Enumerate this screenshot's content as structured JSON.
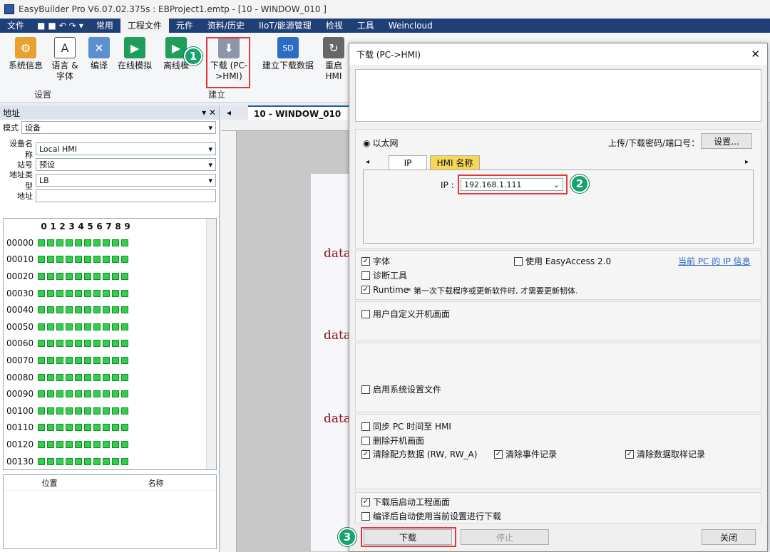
{
  "window": {
    "title": "EasyBuilder Pro V6.07.02.375s : EBProject1.emtp - [10 - WINDOW_010 ]"
  },
  "menu": {
    "items": [
      "文件",
      "常用",
      "工程文件",
      "元件",
      "资料/历史",
      "IIoT/能源管理",
      "检视",
      "工具",
      "Weincloud"
    ],
    "active": "工程文件"
  },
  "ribbon": {
    "buttons": [
      {
        "label": "系统信息"
      },
      {
        "label": "语言 & 字体"
      },
      {
        "label": "编译"
      },
      {
        "label": "在线模拟"
      },
      {
        "label": "离线模"
      },
      {
        "label": "下载 (PC->HMI)"
      },
      {
        "label": "建立下载数据"
      },
      {
        "label": "重启 HMI"
      }
    ],
    "group_settings": "设置",
    "group_build": "建立",
    "sd_text": "SD"
  },
  "badges": [
    "1",
    "2",
    "3"
  ],
  "left_panel": {
    "title": "地址",
    "mode_label": "模式",
    "mode_value": "设备",
    "device_label": "设备名称",
    "device_value": "Local HMI",
    "station_label": "站号",
    "station_value": "预设",
    "addrtype_label": "地址类型",
    "addrtype_value": "LB",
    "addr_label": "地址",
    "addr_value": "",
    "digits": [
      "0",
      "1",
      "2",
      "3",
      "4",
      "5",
      "6",
      "7",
      "8",
      "9"
    ],
    "rows": [
      "00000",
      "00010",
      "00020",
      "00030",
      "00040",
      "00050",
      "00060",
      "00070",
      "00080",
      "00090",
      "00100",
      "00110",
      "00120",
      "00130"
    ],
    "table_headers": [
      "位置",
      "名称"
    ]
  },
  "editor": {
    "tab": "10 - WINDOW_010",
    "labels": [
      "data",
      "data",
      "data"
    ]
  },
  "dialog": {
    "title": "下载 (PC->HMI)",
    "ethernet": "以太网",
    "password_label": "上传/下载密码/端口号：",
    "settings_btn": "设置...",
    "tab_ip": "IP",
    "tab_hmi": "HMI 名称",
    "ip_label": "IP :",
    "ip_value": "192.168.1.111",
    "fonts": "字体",
    "easyaccess": "使用 EasyAccess 2.0",
    "pc_ip_info": "当前 PC 的 IP 信息",
    "diag": "诊断工具",
    "runtime": "Runtime",
    "runtime_note": "* 第一次下载程序或更新软件时, 才需要更新韧体.",
    "custom_boot": "用户自定义开机画面",
    "sys_settings": "启用系统设置文件",
    "sync_time": "同步 PC 时间至 HMI",
    "delete_boot": "删除开机画面",
    "clear_recipe": "清除配方数据 (RW, RW_A)",
    "clear_event": "清除事件记录",
    "clear_sample": "清除数据取样记录",
    "start_after": "下载后启动工程画面",
    "auto_after_compile": "编译后自动使用当前设置进行下载",
    "download_btn": "下载",
    "stop_btn": "停止",
    "close_btn": "关闭"
  }
}
